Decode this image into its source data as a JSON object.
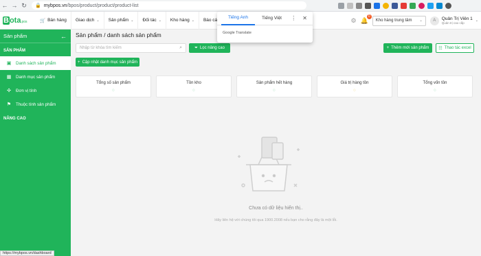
{
  "browser": {
    "url_host": "mybpos.vn",
    "url_path": "/bpos/product/product/product-list"
  },
  "logo": {
    "b": "B",
    "ota": "ota",
    "pos": "pos"
  },
  "menu": [
    {
      "label": "Bán hàng",
      "has_icon": true
    },
    {
      "label": "Giao dịch"
    },
    {
      "label": "Sản phẩm"
    },
    {
      "label": "Đối tác"
    },
    {
      "label": "Kho hàng"
    },
    {
      "label": "Báo cáo"
    }
  ],
  "header": {
    "warehouse": "Kho hàng trung tâm",
    "notif_count": "0",
    "user_name": "Quản Trị Viên 1",
    "user_role": "Quản trị cao cấp"
  },
  "sidebar": {
    "title": "Sản phẩm",
    "section1": "SẢN PHẨM",
    "items": [
      {
        "label": "Danh sách sản phẩm",
        "icon": "box-icon"
      },
      {
        "label": "Danh mục sản phẩm",
        "icon": "table-icon"
      },
      {
        "label": "Đơn vị tính",
        "icon": "settings-icon"
      },
      {
        "label": "Thuộc tính sản phẩm",
        "icon": "tag-icon"
      }
    ],
    "section2": "NÂNG CAO"
  },
  "main": {
    "title": "Sản phẩm / danh sách sản phẩm",
    "search_placeholder": "Nhập từ khóa tìm kiếm",
    "filter_button": "Lọc nâng cao",
    "add_button": "Thêm mới sản phẩm",
    "excel_button": "Thao tác excel",
    "update_category_button": "Cập nhật danh mục sản phẩm",
    "stats": [
      {
        "label": "Tổng số sản phẩm"
      },
      {
        "label": "Tồn kho"
      },
      {
        "label": "Sản phẩm hết hàng"
      },
      {
        "label": "Giá trị hàng tồn"
      },
      {
        "label": "Tổng vốn tồn"
      }
    ],
    "empty_main": "Chưa có dữ liệu hiển thị..",
    "empty_sub": "Hãy liên hệ với chúng tôi qua 1900.2008 nếu bạn cho rằng đây là một lỗi."
  },
  "translate": {
    "tab_english": "Tiếng Anh",
    "tab_vietnamese": "Tiếng Việt",
    "brand": "Google Translate"
  },
  "status_url": "https://mybpos.vn/dashboard",
  "colors": {
    "brand": "#20b45a",
    "accent": "#f15a24"
  }
}
